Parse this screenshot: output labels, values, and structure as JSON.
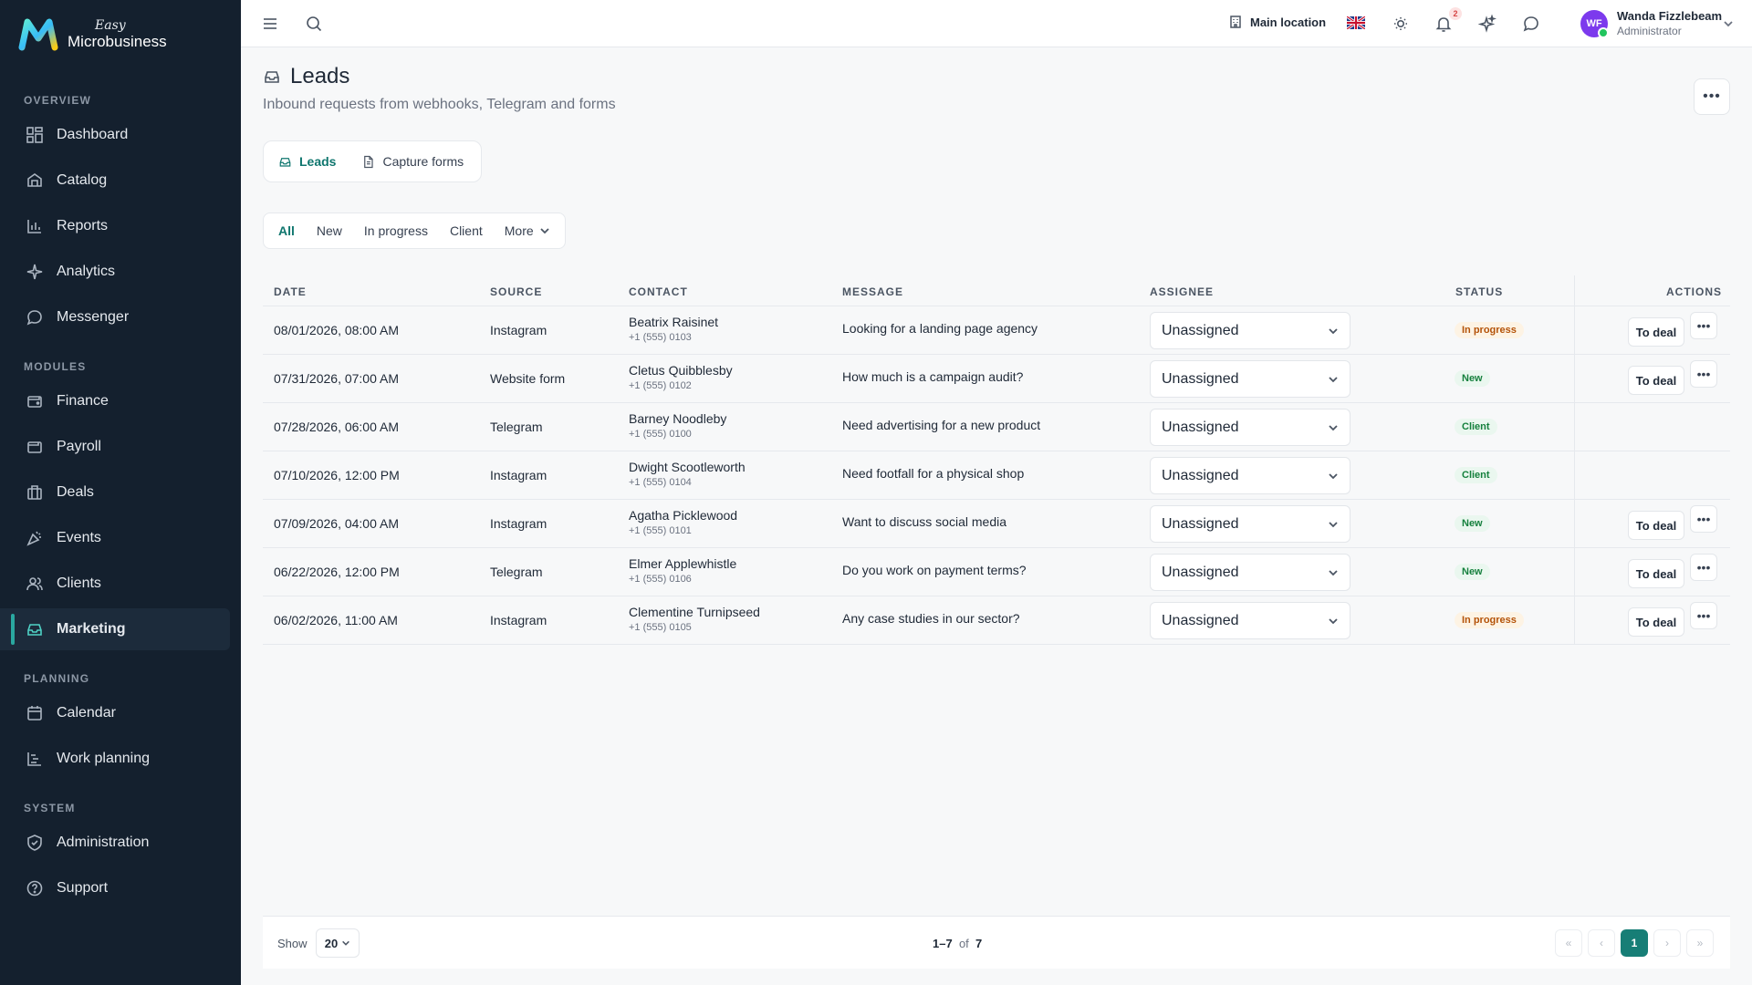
{
  "app": {
    "logo_easy": "Easy",
    "logo_name": "Microbusiness"
  },
  "sidebar": {
    "sections": [
      {
        "label": "OVERVIEW",
        "items": [
          {
            "label": "Dashboard",
            "icon": "dashboard-icon"
          },
          {
            "label": "Catalog",
            "icon": "catalog-icon"
          },
          {
            "label": "Reports",
            "icon": "reports-icon"
          },
          {
            "label": "Analytics",
            "icon": "analytics-icon"
          },
          {
            "label": "Messenger",
            "icon": "messenger-icon"
          }
        ]
      },
      {
        "label": "MODULES",
        "items": [
          {
            "label": "Finance",
            "icon": "finance-icon"
          },
          {
            "label": "Payroll",
            "icon": "payroll-icon"
          },
          {
            "label": "Deals",
            "icon": "deals-icon"
          },
          {
            "label": "Events",
            "icon": "events-icon"
          },
          {
            "label": "Clients",
            "icon": "clients-icon"
          },
          {
            "label": "Marketing",
            "icon": "marketing-icon",
            "active": true
          }
        ]
      },
      {
        "label": "PLANNING",
        "items": [
          {
            "label": "Calendar",
            "icon": "calendar-icon"
          },
          {
            "label": "Work planning",
            "icon": "work-planning-icon"
          }
        ]
      },
      {
        "label": "SYSTEM",
        "items": [
          {
            "label": "Administration",
            "icon": "shield-icon"
          },
          {
            "label": "Support",
            "icon": "help-icon"
          }
        ]
      }
    ]
  },
  "topbar": {
    "location": "Main location",
    "notification_count": "2",
    "user_initials": "WF",
    "user_name": "Wanda Fizzlebeam",
    "user_role": "Administrator",
    "accent_color": "#177e76"
  },
  "page": {
    "title": "Leads",
    "subtitle": "Inbound requests from webhooks, Telegram and forms",
    "menu_glyph": "•••"
  },
  "tabs": [
    {
      "label": "Leads",
      "active": true
    },
    {
      "label": "Capture forms",
      "active": false
    }
  ],
  "filters": {
    "items": [
      "All",
      "New",
      "In progress",
      "Client"
    ],
    "more_label": "More",
    "active": "All"
  },
  "table": {
    "headers": {
      "date": "DATE",
      "source": "SOURCE",
      "contact": "CONTACT",
      "message": "MESSAGE",
      "assignee": "ASSIGNEE",
      "status": "STATUS",
      "actions": "ACTIONS"
    },
    "rows": [
      {
        "date": "08/01/2026, 08:00 AM",
        "source": "Instagram",
        "name": "Beatrix Raisinet",
        "phone": "+1 (555) 0103",
        "message": "Looking for a landing page agency",
        "assignee": "Unassigned",
        "status": "In progress",
        "status_kind": "inprogress",
        "action": "To deal"
      },
      {
        "date": "07/31/2026, 07:00 AM",
        "source": "Website form",
        "name": "Cletus Quibblesby",
        "phone": "+1 (555) 0102",
        "message": "How much is a campaign audit?",
        "assignee": "Unassigned",
        "status": "New",
        "status_kind": "new",
        "action": "To deal"
      },
      {
        "date": "07/28/2026, 06:00 AM",
        "source": "Telegram",
        "name": "Barney Noodleby",
        "phone": "+1 (555) 0100",
        "message": "Need advertising for a new product",
        "assignee": "Unassigned",
        "status": "Client",
        "status_kind": "client",
        "action": ""
      },
      {
        "date": "07/10/2026, 12:00 PM",
        "source": "Instagram",
        "name": "Dwight Scootleworth",
        "phone": "+1 (555) 0104",
        "message": "Need footfall for a physical shop",
        "assignee": "Unassigned",
        "status": "Client",
        "status_kind": "client",
        "action": ""
      },
      {
        "date": "07/09/2026, 04:00 AM",
        "source": "Instagram",
        "name": "Agatha Picklewood",
        "phone": "+1 (555) 0101",
        "message": "Want to discuss social media",
        "assignee": "Unassigned",
        "status": "New",
        "status_kind": "new",
        "action": "To deal"
      },
      {
        "date": "06/22/2026, 12:00 PM",
        "source": "Telegram",
        "name": "Elmer Applewhistle",
        "phone": "+1 (555) 0106",
        "message": "Do you work on payment terms?",
        "assignee": "Unassigned",
        "status": "New",
        "status_kind": "new",
        "action": "To deal"
      },
      {
        "date": "06/02/2026, 11:00 AM",
        "source": "Instagram",
        "name": "Clementine Turnipseed",
        "phone": "+1 (555) 0105",
        "message": "Any case studies in our sector?",
        "assignee": "Unassigned",
        "status": "In progress",
        "status_kind": "inprogress",
        "action": "To deal"
      }
    ]
  },
  "footer": {
    "show_label": "Show",
    "page_size": "20",
    "range": "1–7",
    "of_label": "of",
    "total": "7",
    "current_page": "1"
  }
}
